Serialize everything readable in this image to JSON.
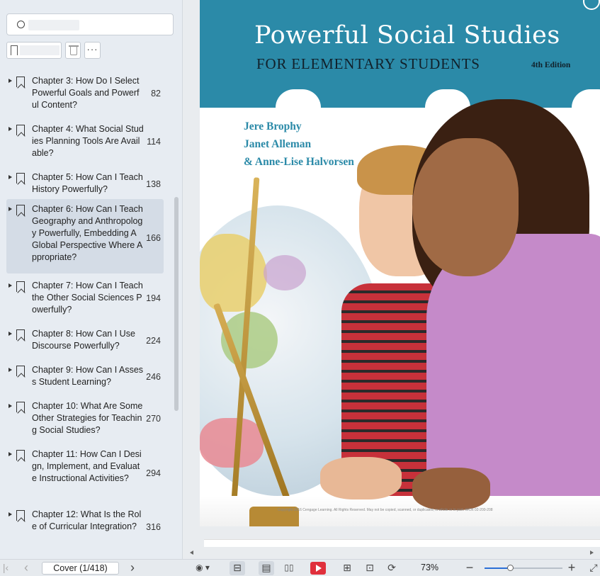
{
  "sidebar": {
    "search": {
      "placeholder": ""
    },
    "toolbar": {
      "more_label": "···"
    },
    "toc": [
      {
        "title": "Chapter 3: How Do I Select Powerful Goals and Powerful Content?",
        "page": "82"
      },
      {
        "title": "Chapter 4: What Social Studies Planning Tools Are Available?",
        "page": "114"
      },
      {
        "title": "Chapter 5: How Can I Teach History Powerfully?",
        "page": "138"
      },
      {
        "title": "Chapter 6: How Can I Teach Geography and Anthropology Powerfully, Embedding A Global Perspective Where Appropriate?",
        "page": "166"
      },
      {
        "title": "Chapter 7: How Can I Teach the Other Social Sciences Powerfully?",
        "page": "194"
      },
      {
        "title": "Chapter 8: How Can I Use Discourse Powerfully?",
        "page": "224"
      },
      {
        "title": "Chapter 9: How Can I Assess Student Learning?",
        "page": "246"
      },
      {
        "title": "Chapter 10: What Are Some Other Strategies for Teaching Social Studies?",
        "page": "270"
      },
      {
        "title": "Chapter 11: How Can I Design, Implement, and Evaluate Instructional Activities?",
        "page": "294"
      },
      {
        "title": "Chapter 12: What Is the Role of Curricular Integration?",
        "page": "316"
      }
    ]
  },
  "cover": {
    "title": "Powerful Social Studies",
    "subtitle": "FOR ELEMENTARY STUDENTS",
    "edition": "4th Edition",
    "authors": [
      "Jere Brophy",
      "Janet Alleman",
      "& Anne-Lise Halvorsen"
    ],
    "copyright": "Copyright 2016 Cengage Learning. All Rights Reserved. May not be copied, scanned, or duplicated, in whole or in part. WCN 02-200-208"
  },
  "bottombar": {
    "first_icon": "|‹",
    "prev_icon": "‹",
    "page_indicator": "Cover (1/418)",
    "next_icon": "›",
    "eye_icon": "◉ ▾",
    "fit_width_icon": "⊟",
    "single_icon": "▤",
    "double_icon": "▯▯",
    "column_icon": "⊞",
    "fit_page_icon": "⊡",
    "rotate_icon": "⟳",
    "zoom": "73%",
    "zoom_out_icon": "−",
    "zoom_in_icon": "+",
    "fullscreen_icon": "⤢",
    "zoom_level": 0.33
  }
}
